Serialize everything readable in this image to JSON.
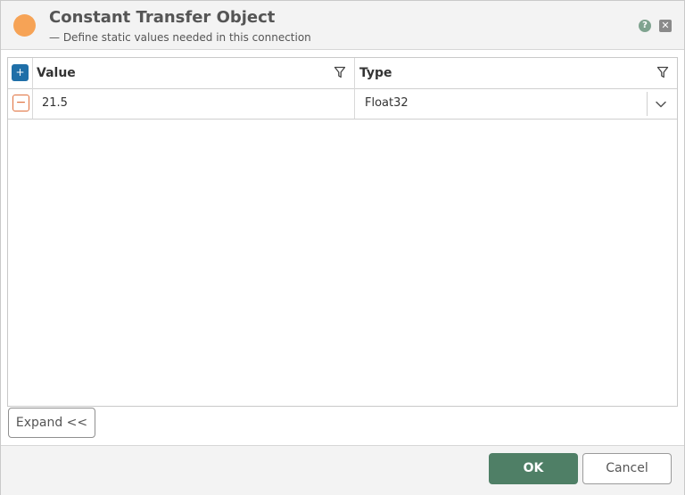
{
  "dialog": {
    "title": "Constant Transfer Object",
    "subtitle": "— Define static values needed in this connection",
    "help_icon": "?",
    "close_icon": "✕"
  },
  "grid": {
    "add_label": "+",
    "columns": {
      "value": "Value",
      "type": "Type"
    },
    "rows": [
      {
        "remove_label": "−",
        "value": "21.5",
        "type": "Float32"
      }
    ]
  },
  "expand_button": "Expand <<",
  "footer": {
    "ok": "OK",
    "cancel": "Cancel"
  },
  "colors": {
    "status_dot": "#f6a356",
    "add_button": "#1f6fa8",
    "remove_button": "#e0703d",
    "ok_button": "#4f7f66"
  }
}
